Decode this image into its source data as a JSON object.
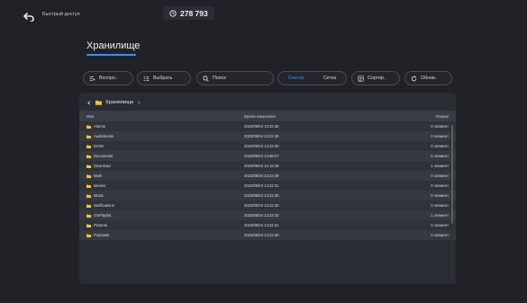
{
  "topbar": {
    "title": "Быстрый доступ",
    "counter": "278 793"
  },
  "page": {
    "heading": "Хранилище"
  },
  "toolbar": {
    "play_label": "Воспро..",
    "select_label": "Выбрать",
    "search_placeholder": "Поиск",
    "view_list_label": "Список",
    "view_grid_label": "Сетка",
    "sort_label": "Сортир..",
    "refresh_label": "Обнов.."
  },
  "breadcrumb": {
    "path": "Хранилище"
  },
  "table": {
    "columns": {
      "name": "Имя",
      "modified": "Время изменения",
      "size": "Размер"
    },
    "rows": [
      {
        "name": "Alarms",
        "modified": "2023/05/04 13:22:30",
        "size": "0 элемент"
      },
      {
        "name": "Audiobooks",
        "modified": "2023/05/04 13:22:30",
        "size": "0 элемент"
      },
      {
        "name": "DCIM",
        "modified": "2023/05/04 13:22:30",
        "size": "0 элемент"
      },
      {
        "name": "Documents",
        "modified": "2023/05/04 13:58:27",
        "size": "0 элемент"
      },
      {
        "name": "Download",
        "modified": "2023/05/04 12:19:39",
        "size": "1 элемент"
      },
      {
        "name": "Mark",
        "modified": "2023/05/04 13:22:39",
        "size": "0 элемент"
      },
      {
        "name": "Movies",
        "modified": "2023/05/04 13:22:31",
        "size": "0 элемент"
      },
      {
        "name": "Music",
        "modified": "2023/05/04 13:22:30",
        "size": "0 элемент"
      },
      {
        "name": "Notifications",
        "modified": "2023/05/04 13:22:30",
        "size": "0 элемент"
      },
      {
        "name": "OSPlaylist",
        "modified": "2023/05/04 13:22:32",
        "size": "1 элемент"
      },
      {
        "name": "Pictures",
        "modified": "2023/05/04 13:22:31",
        "size": "0 элемент"
      },
      {
        "name": "Podcasts",
        "modified": "2023/05/04 13:22:30",
        "size": "0 элемент"
      }
    ]
  },
  "colors": {
    "accent": "#3d8bff",
    "folder": "#f2c230",
    "background": "#202228",
    "panel": "#2a2c33"
  },
  "icons": {
    "back": "back-arrow-icon",
    "counter": "clock-badge-icon",
    "play": "play-list-icon",
    "select": "checklist-icon",
    "search": "search-icon",
    "sort": "sort-icon",
    "refresh": "refresh-icon",
    "folder": "folder-icon"
  }
}
